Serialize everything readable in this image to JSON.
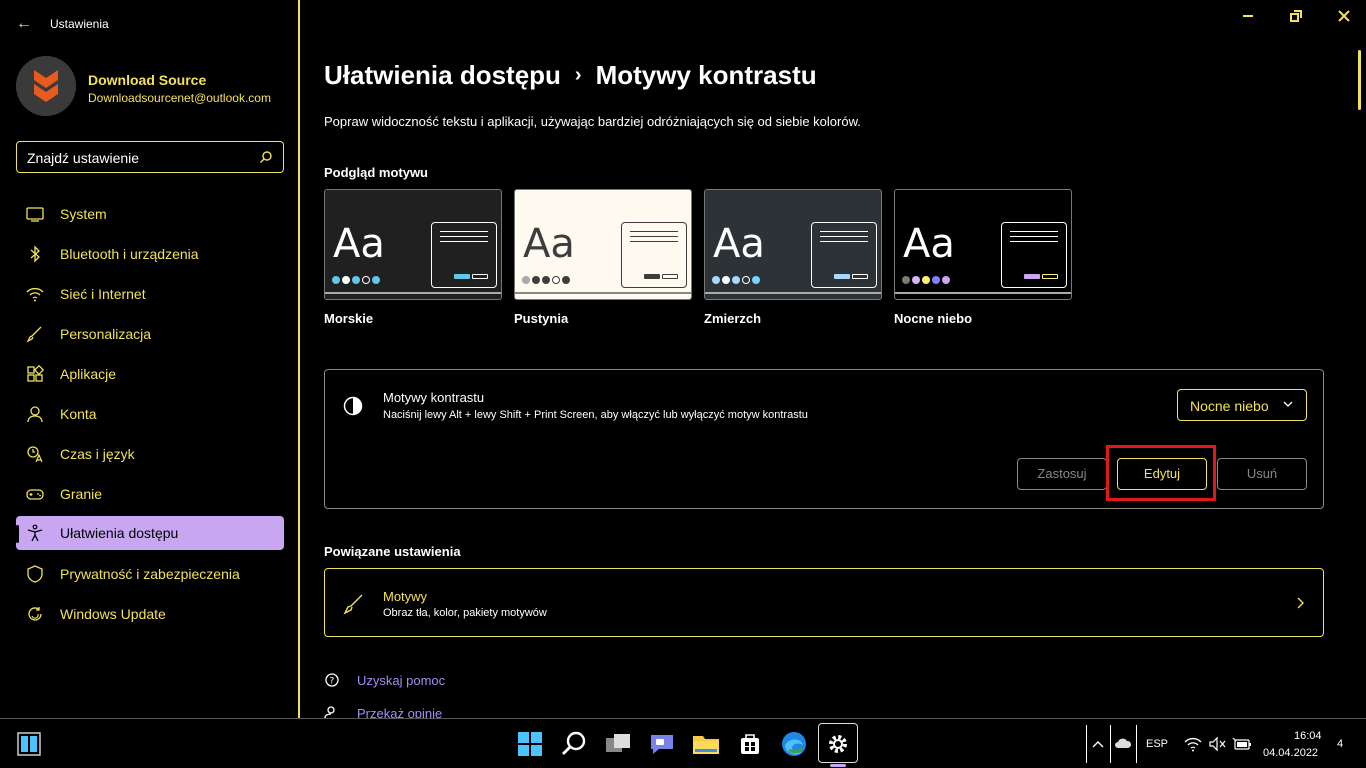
{
  "app": {
    "title": "Ustawienia"
  },
  "user": {
    "name": "Download Source",
    "email": "Downloadsourcenet@outlook.com"
  },
  "search": {
    "placeholder": "Znajdź ustawienie"
  },
  "sidebar": {
    "items": [
      {
        "label": "System",
        "icon": "monitor-icon"
      },
      {
        "label": "Bluetooth i urządzenia",
        "icon": "bluetooth-icon"
      },
      {
        "label": "Sieć i Internet",
        "icon": "wifi-icon"
      },
      {
        "label": "Personalizacja",
        "icon": "brush-icon"
      },
      {
        "label": "Aplikacje",
        "icon": "apps-icon"
      },
      {
        "label": "Konta",
        "icon": "person-icon"
      },
      {
        "label": "Czas i język",
        "icon": "clock-language-icon"
      },
      {
        "label": "Granie",
        "icon": "gamepad-icon"
      },
      {
        "label": "Ułatwienia dostępu",
        "icon": "accessibility-icon",
        "active": true
      },
      {
        "label": "Prywatność i zabezpieczenia",
        "icon": "shield-icon"
      },
      {
        "label": "Windows Update",
        "icon": "update-icon"
      }
    ]
  },
  "header": {
    "parent": "Ułatwienia dostępu",
    "current": "Motywy kontrastu",
    "separator": "›"
  },
  "intro": "Popraw widoczność tekstu i aplikacji, używając bardziej odróżniających się od siebie kolorów.",
  "preview": {
    "heading": "Podgląd motywu",
    "themes": [
      {
        "name": "Morskie",
        "sample": "Aa",
        "bg": "#202020",
        "fg": "#ffffff",
        "dots": [
          "#5ec8e8",
          "#ffffff",
          "#5ec8e8",
          "#202020",
          "#5ec8e8"
        ]
      },
      {
        "name": "Pustynia",
        "sample": "Aa",
        "bg": "#fffaef",
        "fg": "#3d3d3d",
        "dots": [
          "#a9a9a9",
          "#3d3d3d",
          "#3d3d3d",
          "#fffaef",
          "#3d3d3d"
        ]
      },
      {
        "name": "Zmierzch",
        "sample": "Aa",
        "bg": "#2d3236",
        "fg": "#ffffff",
        "dots": [
          "#a6d8ff",
          "#ffffff",
          "#a6d8ff",
          "#2d3236",
          "#76d5ff"
        ]
      },
      {
        "name": "Nocne niebo",
        "sample": "Aa",
        "bg": "#000000",
        "fg": "#ffffff",
        "dots": [
          "#807a6e",
          "#d6b4fd",
          "#fff270",
          "#8080ff",
          "#c9a6f2"
        ]
      }
    ]
  },
  "contrast": {
    "title": "Motywy kontrastu",
    "description": "Naciśnij lewy Alt + lewy Shift + Print Screen, aby włączyć lub wyłączyć motyw kontrastu",
    "selected": "Nocne niebo",
    "apply_label": "Zastosuj",
    "edit_label": "Edytuj",
    "remove_label": "Usuń"
  },
  "related": {
    "heading": "Powiązane ustawienia",
    "themes_title": "Motywy",
    "themes_desc": "Obraz tła, kolor, pakiety motywów"
  },
  "help": {
    "get_help": "Uzyskaj pomoc",
    "feedback": "Przekaż opinię"
  },
  "taskbar": {
    "lang": "ESP",
    "time": "16:04",
    "date": "04.04.2022",
    "notifications": "4"
  },
  "colors": {
    "accent": "#f2e15a",
    "selection": "#c9a6f2",
    "link": "#a58cf5",
    "highlight": "#e4161b"
  }
}
